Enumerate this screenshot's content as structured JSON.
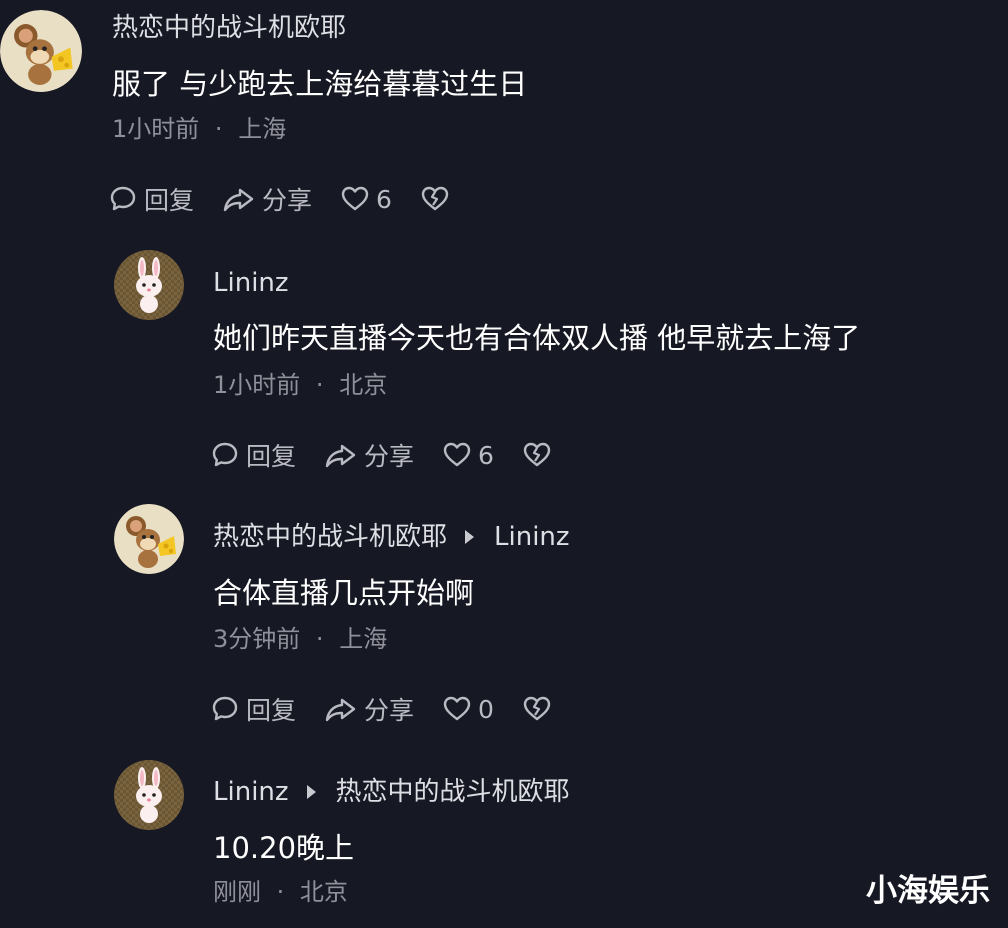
{
  "comments": [
    {
      "username": "热恋中的战斗机欧耶",
      "reply_to": "",
      "text": "服了 与少跑去上海给暮暮过生日",
      "time": "1小时前",
      "location": "上海",
      "reply_label": "回复",
      "share_label": "分享",
      "likes": "6",
      "avatar_icon": "mouse-cheese-avatar"
    },
    {
      "username": "Lininz",
      "reply_to": "",
      "text": "她们昨天直播今天也有合体双人播 他早就去上海了",
      "time": "1小时前",
      "location": "北京",
      "reply_label": "回复",
      "share_label": "分享",
      "likes": "6",
      "avatar_icon": "bunny-avatar"
    },
    {
      "username": "热恋中的战斗机欧耶",
      "reply_to": "Lininz",
      "text": "合体直播几点开始啊",
      "time": "3分钟前",
      "location": "上海",
      "reply_label": "回复",
      "share_label": "分享",
      "likes": "0",
      "avatar_icon": "mouse-cheese-avatar"
    },
    {
      "username": "Lininz",
      "reply_to": "热恋中的战斗机欧耶",
      "text": "10.20晚上",
      "time": "刚刚",
      "location": "北京",
      "avatar_icon": "bunny-avatar"
    }
  ],
  "separator": "·",
  "watermark": "小海娱乐",
  "colors": {
    "background": "#161823",
    "text": "#ffffff",
    "meta": "#8f909a",
    "action": "#b9bac2"
  }
}
